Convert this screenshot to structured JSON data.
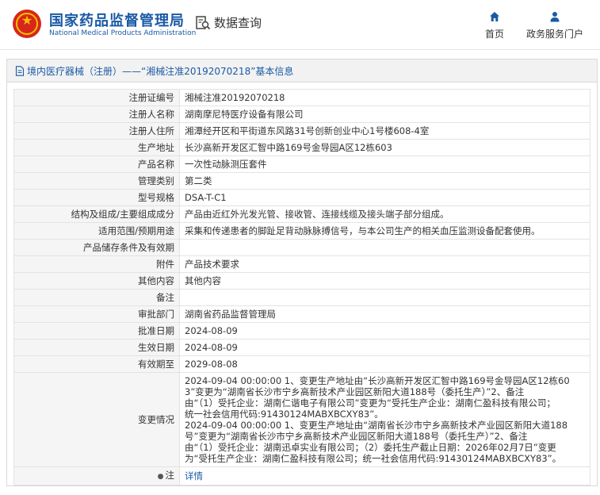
{
  "header": {
    "brand_cn": "国家药品监督管理局",
    "brand_en": "National Medical Products Administration",
    "query_label": "数据查询",
    "nav": [
      {
        "label": "首页",
        "icon": "home-icon"
      },
      {
        "label": "政务服务门户",
        "icon": "user-icon"
      }
    ]
  },
  "panel": {
    "title": "境内医疗器械（注册）——“湘械注准20192070218”基本信息"
  },
  "rows": [
    {
      "label": "注册证编号",
      "value": "湘械注准20192070218"
    },
    {
      "label": "注册人名称",
      "value": "湖南摩尼特医疗设备有限公司"
    },
    {
      "label": "注册人住所",
      "value": "湘潭经开区和平街道东风路31号创新创业中心1号楼608-4室"
    },
    {
      "label": "生产地址",
      "value": "长沙高新开发区汇智中路169号金导园A区12栋603"
    },
    {
      "label": "产品名称",
      "value": "一次性动脉测压套件"
    },
    {
      "label": "管理类别",
      "value": "第二类"
    },
    {
      "label": "型号规格",
      "value": "DSA-T-C1"
    },
    {
      "label": "结构及组成/主要组成成分",
      "value": "产品由近红外光发光管、接收管、连接线缆及接头端子部分组成。"
    },
    {
      "label": "适用范围/预期用途",
      "value": "采集和传递患者的脚趾足背动脉脉搏信号，与本公司生产的相关血压监测设备配套使用。"
    },
    {
      "label": "产品储存条件及有效期",
      "value": ""
    },
    {
      "label": "附件",
      "value": "产品技术要求"
    },
    {
      "label": "其他内容",
      "value": "其他内容"
    },
    {
      "label": "备注",
      "value": ""
    },
    {
      "label": "审批部门",
      "value": "湖南省药品监督管理局"
    },
    {
      "label": "批准日期",
      "value": "2024-08-09"
    },
    {
      "label": "生效日期",
      "value": "2024-08-09"
    },
    {
      "label": "有效期至",
      "value": "2029-08-08"
    }
  ],
  "change": {
    "label": "变更情况",
    "lines": [
      "2024-09-04 00:00:00 1、变更生产地址由“长沙高新开发区汇智中路169号金导园A区12栋60",
      "3”变更为“湖南省长沙市宁乡高新技术产业园区新阳大道188号（委托生产）”2、备注",
      "由“（1）受托企业：湖南仁谐电子有限公司”变更为“受托生产企业：湖南仁盈科技有限公司；",
      "统一社会信用代码:91430124MABXBCXY83”。",
      "2024-09-04 00:00:00 1、变更生产地址由“湖南省长沙市宁乡高新技术产业园区新阳大道188",
      "号”变更为“湖南省长沙市宁乡高新技术产业园区新阳大道188号（委托生产）”2、备注",
      "由“（1）受托企业：湖南迅卓实业有限公司；（2）委托生产截止日期：2026年02月7日”变更",
      "为“受托生产企业：湖南仁盈科技有限公司；统一社会信用代码:91430124MABXBCXY83”。"
    ]
  },
  "note": {
    "label": "注",
    "icon": "lightbulb-icon",
    "link": "详情"
  }
}
